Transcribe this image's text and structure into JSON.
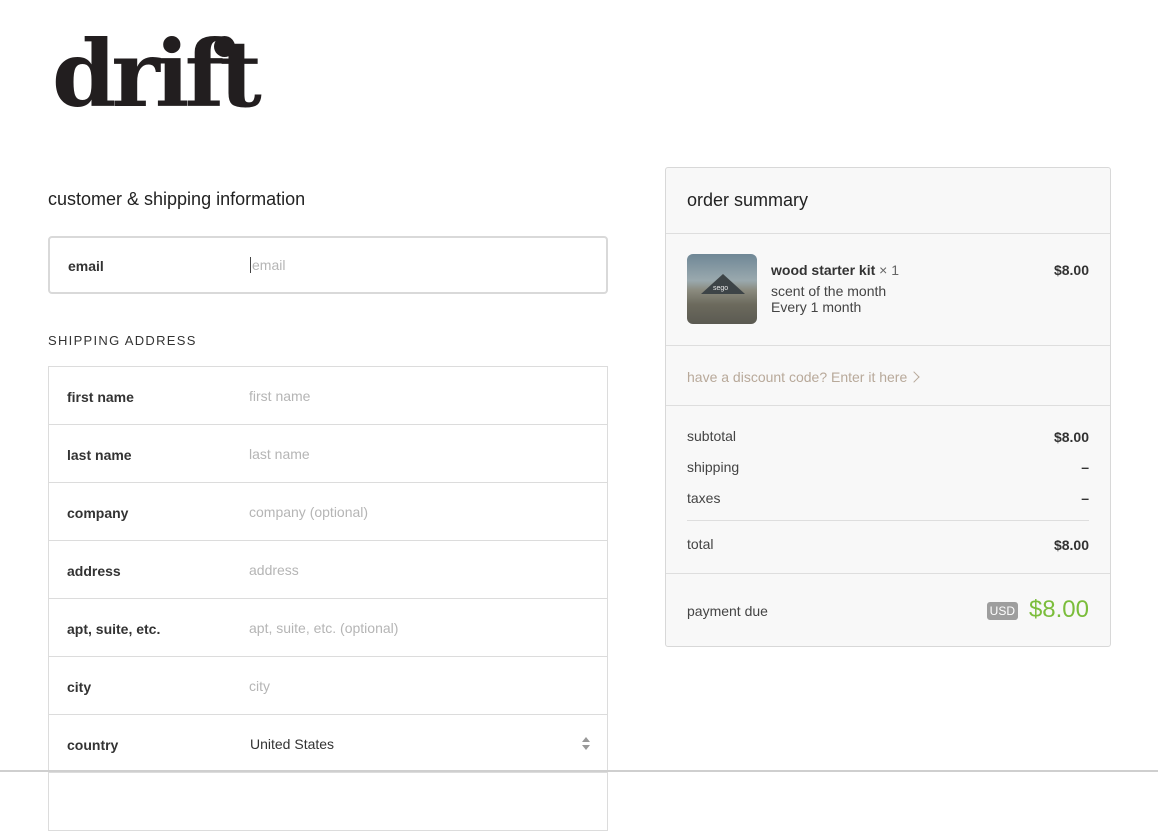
{
  "brand": {
    "logo_text": "drift"
  },
  "customer": {
    "section_title": "customer & shipping information",
    "email_label": "email",
    "email_placeholder": "email",
    "email_value": ""
  },
  "shipping": {
    "heading": "SHIPPING ADDRESS",
    "fields": [
      {
        "label": "first name",
        "placeholder": "first name"
      },
      {
        "label": "last name",
        "placeholder": "last name"
      },
      {
        "label": "company",
        "placeholder": "company (optional)"
      },
      {
        "label": "address",
        "placeholder": "address"
      },
      {
        "label": "apt, suite, etc.",
        "placeholder": "apt, suite, etc. (optional)"
      },
      {
        "label": "city",
        "placeholder": "city"
      }
    ],
    "country": {
      "label": "country",
      "value": "United States"
    }
  },
  "summary": {
    "title": "order summary",
    "item": {
      "name": "wood starter kit",
      "qty": "× 1",
      "line1": "scent of the month",
      "line2": "Every 1 month",
      "price": "$8.00",
      "image_brand": "sego"
    },
    "discount_link": "have a discount code? Enter it here",
    "subtotal_label": "subtotal",
    "subtotal_value": "$8.00",
    "shipping_label": "shipping",
    "shipping_value": "–",
    "taxes_label": "taxes",
    "taxes_value": "–",
    "total_label": "total",
    "total_value": "$8.00",
    "payment_due_label": "payment due",
    "currency": "USD",
    "payment_due_value": "$8.00"
  },
  "colors": {
    "accent_green": "#7bbd3b",
    "discount_link": "#b8a99a",
    "logo": "#221e1f"
  },
  "icons": {
    "discount_chevron": "chevron-right-icon",
    "country_select": "select-arrows-icon"
  }
}
